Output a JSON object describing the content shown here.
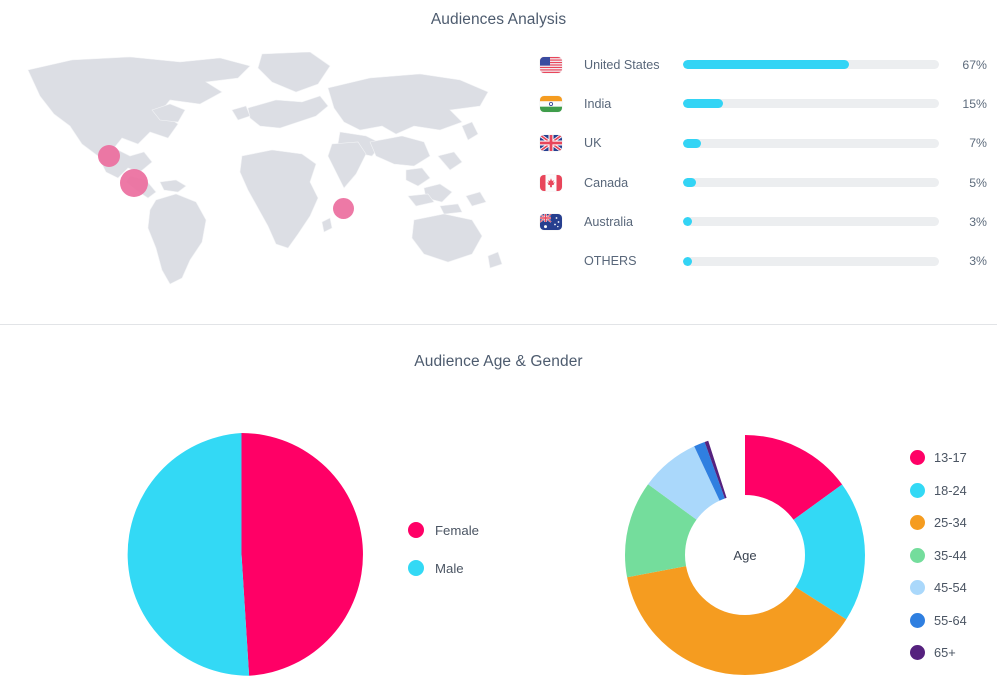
{
  "audiences": {
    "title": "Audiences Analysis",
    "map": {
      "name": "world-map",
      "land_color": "#dcdee4",
      "bubble_color": "#ec6e9e",
      "bubbles": [
        {
          "label": "Canada",
          "x": 88,
          "y": 93,
          "size": 22
        },
        {
          "label": "United States",
          "x": 110,
          "y": 117,
          "size": 28
        },
        {
          "label": "India",
          "x": 323,
          "y": 146,
          "size": 21
        }
      ]
    },
    "bar_fill_color": "#33d4f5",
    "bar_track_color": "#eceef0",
    "countries": [
      {
        "name": "United States",
        "percent": "67%",
        "value": 67,
        "flag": "flag-us"
      },
      {
        "name": "India",
        "percent": "15%",
        "value": 15,
        "flag": "flag-in"
      },
      {
        "name": "UK",
        "percent": "7%",
        "value": 7,
        "flag": "flag-gb"
      },
      {
        "name": "Canada",
        "percent": "5%",
        "value": 5,
        "flag": "flag-ca"
      },
      {
        "name": "Australia",
        "percent": "3%",
        "value": 3,
        "flag": "flag-au"
      },
      {
        "name": "OTHERS",
        "percent": "3%",
        "value": 3,
        "flag": "none"
      }
    ]
  },
  "age_gender": {
    "title": "Audience Age & Gender",
    "donut_center_label": "Age"
  },
  "chart_data": [
    {
      "type": "bar",
      "title": "Audiences Analysis",
      "orientation": "horizontal",
      "categories": [
        "United States",
        "India",
        "UK",
        "Canada",
        "Australia",
        "OTHERS"
      ],
      "values": [
        67,
        15,
        7,
        5,
        3,
        3
      ],
      "unit": "%",
      "xlabel": "",
      "ylabel": "",
      "xlim": [
        0,
        100
      ],
      "grid": false,
      "legend": "none",
      "series_color": "#33d4f5"
    },
    {
      "type": "pie",
      "title": "Gender",
      "labels": [
        "Female",
        "Male"
      ],
      "values": [
        49,
        51
      ],
      "colors": [
        "#ff0066",
        "#33d9f5"
      ],
      "legend": "right",
      "start_angle_deg": 0,
      "direction": "clockwise"
    },
    {
      "type": "pie",
      "subtype": "donut",
      "title": "Age",
      "center_label": "Age",
      "labels": [
        "13-17",
        "18-24",
        "25-34",
        "35-44",
        "45-54",
        "55-64",
        "65+"
      ],
      "values": [
        15,
        19,
        38,
        13,
        8,
        1.5,
        0.5
      ],
      "colors": [
        "#ff0066",
        "#33d9f5",
        "#f59c20",
        "#74dd9c",
        "#aad8fb",
        "#2f7fe0",
        "#55217e"
      ],
      "legend": "right",
      "start_angle_deg": 0,
      "direction": "clockwise",
      "inner_radius_ratio": 0.58
    }
  ],
  "gender_legend": [
    {
      "label": "Female",
      "color": "#ff0066"
    },
    {
      "label": "Male",
      "color": "#33d9f5"
    }
  ],
  "age_legend": [
    {
      "label": "13-17",
      "color": "#ff0066"
    },
    {
      "label": "18-24",
      "color": "#33d9f5"
    },
    {
      "label": "25-34",
      "color": "#f59c20"
    },
    {
      "label": "35-44",
      "color": "#74dd9c"
    },
    {
      "label": "45-54",
      "color": "#aad8fb"
    },
    {
      "label": "55-64",
      "color": "#2f7fe0"
    },
    {
      "label": "65+",
      "color": "#55217e"
    }
  ]
}
